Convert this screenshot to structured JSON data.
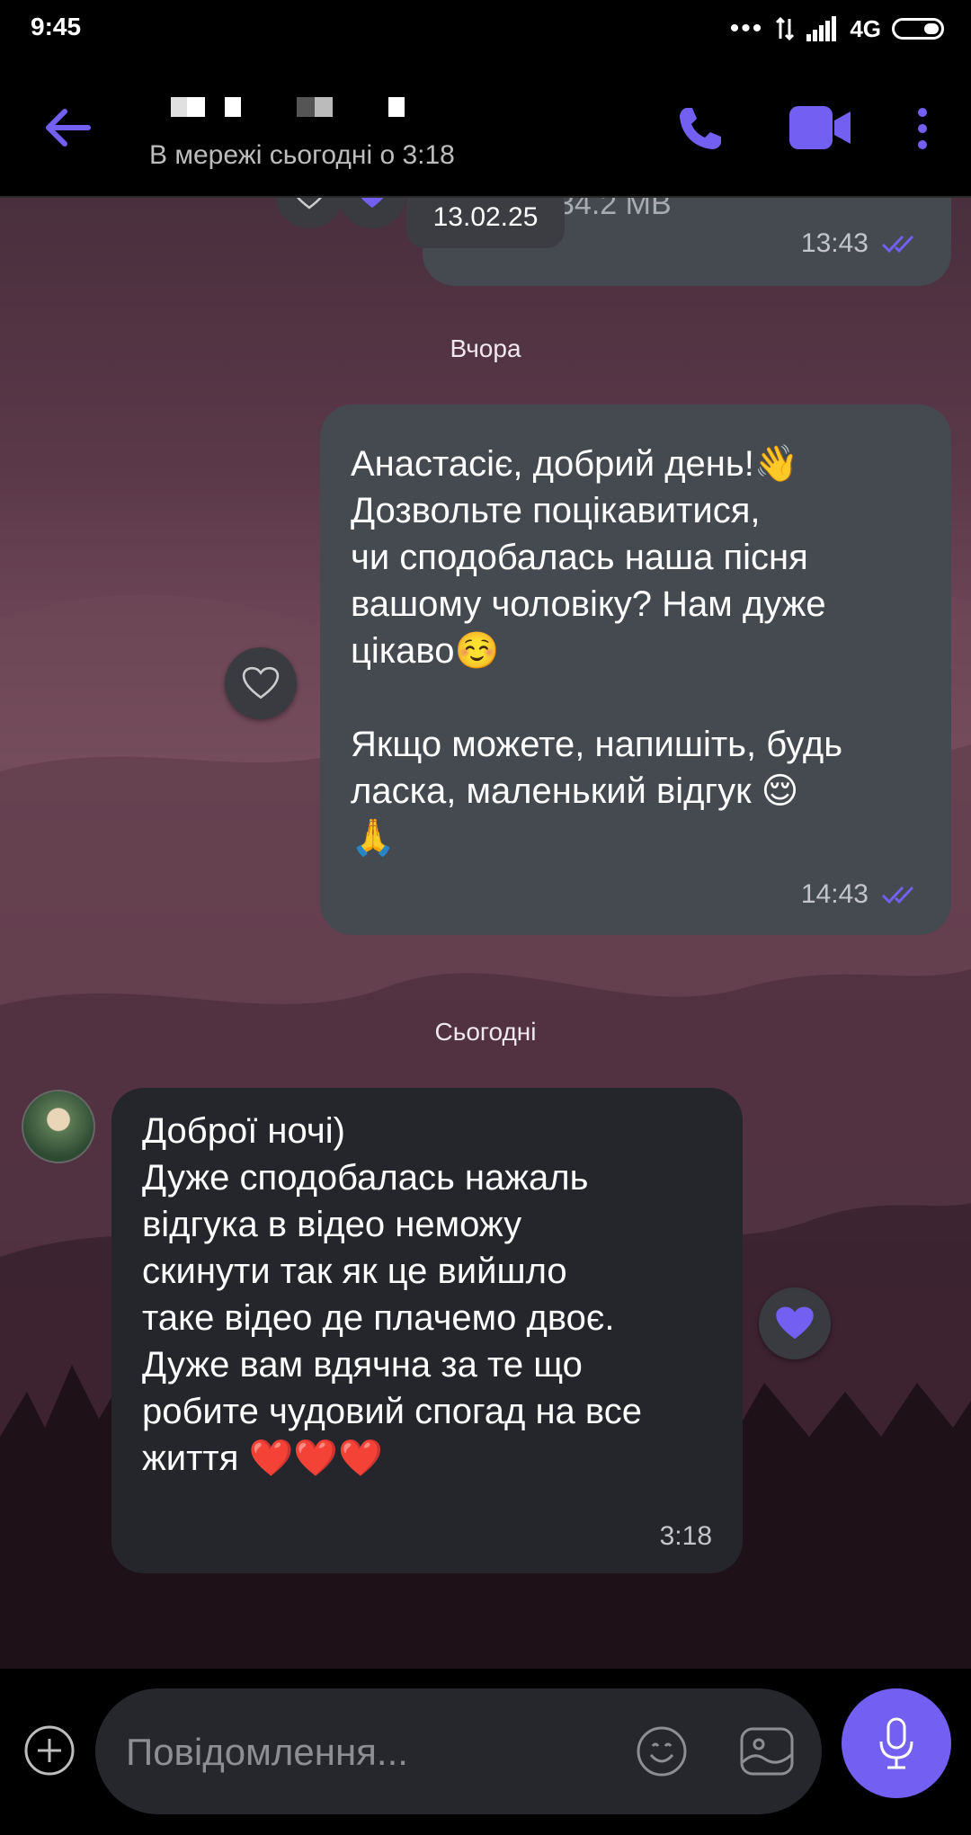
{
  "status_bar": {
    "time": "9:45",
    "dots": "•••",
    "network": "4G",
    "battery_level": 0.3
  },
  "header": {
    "contact_status": "В мережі сьогодні о 3:18",
    "accent_color": "#7360f2"
  },
  "chat": {
    "top_message": {
      "file_size": "34.2 MB",
      "date_badge": "13.02.25",
      "time": "13:43"
    },
    "date_separators": {
      "yesterday": "Вчора",
      "today": "Сьогодні"
    },
    "messages": [
      {
        "direction": "outgoing",
        "text": "Анастасіє, добрий день!👋\nДозвольте поцікавитися,\nчи сподобалась наша пісня\nвашому чоловіку? Нам дуже\nцікаво☺️\n\nЯкщо можете, напишіть, будь\nласка, маленький відгук 😌\n🙏",
        "time": "14:43",
        "status": "read"
      },
      {
        "direction": "incoming",
        "text": "Доброї ночі)\nДуже сподобалась нажаль\nвідгука в відео неможу\nскинути так як це вийшло\nтаке відео де плачемо двоє.\nДуже вам вдячна за те що\nробите чудовий спогад на все\nжиття ❤️❤️❤️",
        "time": "3:18",
        "reaction": "heart"
      }
    ]
  },
  "input": {
    "placeholder": "Повідомлення..."
  }
}
